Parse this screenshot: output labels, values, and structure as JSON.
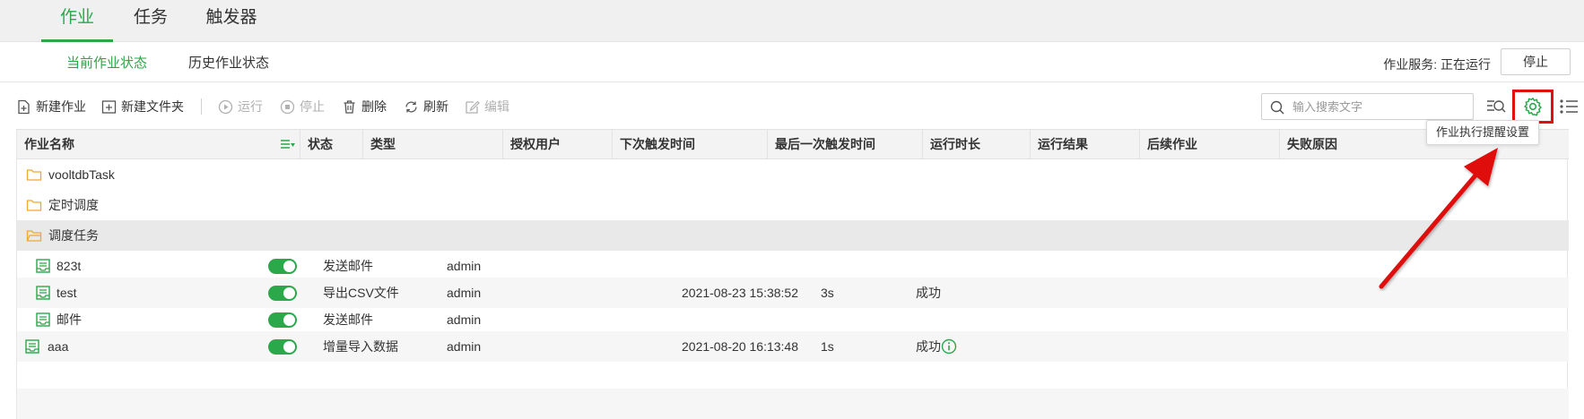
{
  "top_tabs": [
    "作业",
    "任务",
    "触发器"
  ],
  "sub_tabs": [
    "当前作业状态",
    "历史作业状态"
  ],
  "service": {
    "label": "作业服务: 正在运行",
    "stop_label": "停止"
  },
  "toolbar": {
    "new_job": "新建作业",
    "new_folder": "新建文件夹",
    "run": "运行",
    "stop": "停止",
    "delete": "删除",
    "refresh": "刷新",
    "edit": "编辑"
  },
  "search": {
    "placeholder": "输入搜索文字",
    "value": ""
  },
  "tooltip": "作业执行提醒设置",
  "colors": {
    "accent": "#2aa84a",
    "folder": "#f0a830",
    "highlight": "#e01010"
  },
  "columns": [
    "作业名称",
    "状态",
    "类型",
    "授权用户",
    "下次触发时间",
    "最后一次触发时间",
    "运行时长",
    "运行结果",
    "后续作业",
    "失败原因"
  ],
  "folders": [
    {
      "name": "vooltdbTask",
      "icon": "folder-icon"
    },
    {
      "name": "定时调度",
      "icon": "folder-icon"
    },
    {
      "name": "调度任务",
      "icon": "folder-icon"
    }
  ],
  "jobs": [
    {
      "name": "823t",
      "enabled": true,
      "type": "发送邮件",
      "user": "admin",
      "next": "",
      "last": "",
      "duration": "",
      "result": "",
      "has_info": false
    },
    {
      "name": "test",
      "enabled": true,
      "type": "导出CSV文件",
      "user": "admin",
      "next": "",
      "last": "2021-08-23 15:38:52",
      "duration": "3s",
      "result": "成功",
      "has_info": false
    },
    {
      "name": "邮件",
      "enabled": true,
      "type": "发送邮件",
      "user": "admin",
      "next": "",
      "last": "",
      "duration": "",
      "result": "",
      "has_info": false
    },
    {
      "name": "aaa",
      "enabled": true,
      "type": "增量导入数据",
      "user": "admin",
      "next": "",
      "last": "2021-08-20 16:13:48",
      "duration": "1s",
      "result": "成功",
      "has_info": true
    }
  ]
}
